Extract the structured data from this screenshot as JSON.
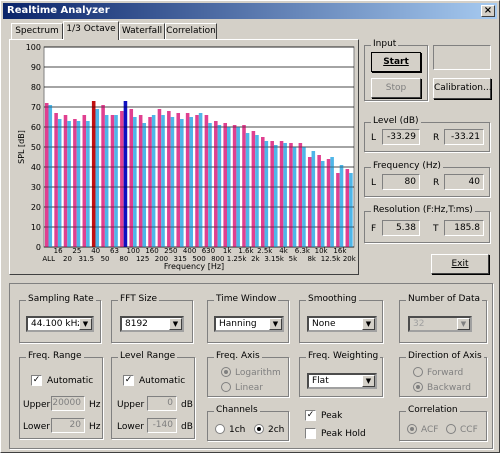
{
  "window": {
    "title": "Realtime Analyzer"
  },
  "tabs": [
    {
      "label": "Spectrum"
    },
    {
      "label": "1/3 Octave"
    },
    {
      "label": "Waterfall"
    },
    {
      "label": "Correlation"
    }
  ],
  "colors": {
    "left": "#4fb6e8",
    "right": "#e04090",
    "peak_left": "#1010c0",
    "peak_right": "#c01010",
    "grid": "#000000"
  },
  "chart_data": {
    "type": "bar",
    "ylabel": "SPL [dB]",
    "xlabel": "Frequency [Hz]",
    "ylim": [
      0,
      100
    ],
    "yticks": [
      "100",
      "90",
      "80",
      "70",
      "60",
      "50",
      "40",
      "30",
      "20",
      "10",
      "0"
    ],
    "xlabels_row1": [
      "16",
      "25",
      "40",
      "63",
      "100",
      "160",
      "250",
      "400",
      "630",
      "1k",
      "1.6k",
      "2.5k",
      "4k",
      "6.3k",
      "10k",
      "16k"
    ],
    "xlabels_row2": [
      "ALL",
      "20",
      "31.5",
      "50",
      "80",
      "125",
      "200",
      "315",
      "500",
      "800",
      "1.25k",
      "2k",
      "3.15k",
      "5k",
      "8k",
      "12.5k",
      "20k"
    ],
    "categories": [
      "ALL",
      "16",
      "20",
      "25",
      "31.5",
      "40",
      "50",
      "63",
      "80",
      "100",
      "125",
      "160",
      "200",
      "250",
      "315",
      "400",
      "500",
      "630",
      "800",
      "1k",
      "1.25k",
      "1.6k",
      "2k",
      "2.5k",
      "3.15k",
      "4k",
      "5k",
      "6.3k",
      "8k",
      "10k",
      "12.5k",
      "16k",
      "20k"
    ],
    "series": [
      {
        "name": "L",
        "values": [
          71,
          64,
          63,
          63,
          63,
          69,
          66,
          66,
          74,
          65,
          62,
          66,
          66,
          65,
          64,
          65,
          67,
          62,
          61,
          60,
          60,
          57,
          56,
          53,
          51,
          52,
          50,
          50,
          48,
          43,
          45,
          41,
          37
        ]
      },
      {
        "name": "R",
        "values": [
          72,
          67,
          66,
          64,
          66,
          70,
          71,
          66,
          68,
          69,
          66,
          65,
          69,
          68,
          67,
          67,
          66,
          66,
          63,
          62,
          61,
          61,
          58,
          55,
          53,
          53,
          52,
          52,
          45,
          46,
          44,
          37,
          39
        ]
      }
    ],
    "peak_bars": [
      {
        "series": "R",
        "index": 5,
        "value": 73
      },
      {
        "series": "L",
        "index": 8,
        "value": 73
      }
    ]
  },
  "input": {
    "title": "Input",
    "start": "Start",
    "stop": "Stop",
    "calibration": "Calibration...",
    "exit": "Exit"
  },
  "level": {
    "title": "Level (dB)",
    "l_label": "L",
    "r_label": "R",
    "l_value": "-33.29",
    "r_value": "-33.21"
  },
  "frequency": {
    "title": "Frequency (Hz)",
    "l_label": "L",
    "r_label": "R",
    "l_value": "80",
    "r_value": "40"
  },
  "resolution": {
    "title": "Resolution (F:Hz,T:ms)",
    "f_label": "F",
    "t_label": "T",
    "f_value": "5.38",
    "t_value": "185.8"
  },
  "sampling_rate": {
    "title": "Sampling Rate",
    "value": "44.100 kHz"
  },
  "fft_size": {
    "title": "FFT Size",
    "value": "8192"
  },
  "time_window": {
    "title": "Time Window",
    "value": "Hanning"
  },
  "smoothing": {
    "title": "Smoothing",
    "value": "None"
  },
  "number_of_data": {
    "title": "Number of Data",
    "value": "32"
  },
  "freq_range": {
    "title": "Freq. Range",
    "auto": "Automatic",
    "upper_label": "Upper",
    "lower_label": "Lower",
    "upper": "20000",
    "lower": "20",
    "unit": "Hz"
  },
  "level_range": {
    "title": "Level Range",
    "auto": "Automatic",
    "upper_label": "Upper",
    "lower_label": "Lower",
    "upper": "0",
    "lower": "-140",
    "unit": "dB"
  },
  "freq_axis": {
    "title": "Freq. Axis",
    "opt1": "Logarithm",
    "opt2": "Linear"
  },
  "freq_weighting": {
    "title": "Freq. Weighting",
    "value": "Flat"
  },
  "direction": {
    "title": "Direction of Axis",
    "opt1": "Forward",
    "opt2": "Backward"
  },
  "channels": {
    "title": "Channels",
    "opt1": "1ch",
    "opt2": "2ch"
  },
  "peak": {
    "peak": "Peak",
    "peak_hold": "Peak Hold"
  },
  "correlation": {
    "title": "Correlation",
    "opt1": "ACF",
    "opt2": "CCF"
  }
}
